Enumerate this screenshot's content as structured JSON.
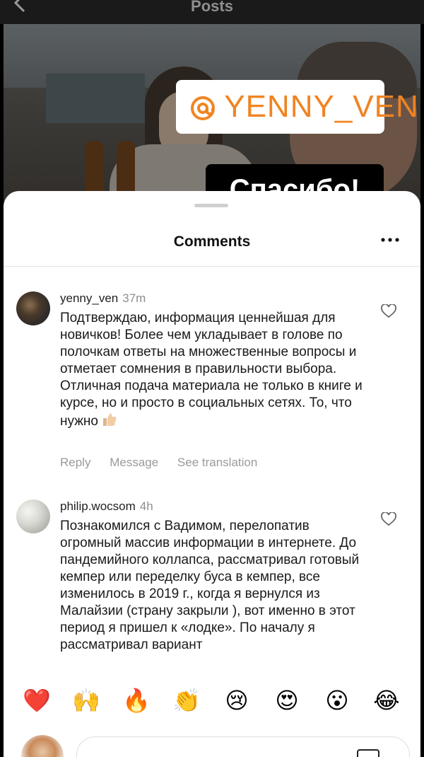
{
  "header": {
    "title": "Posts"
  },
  "story": {
    "tag_handle": "YENNY_VEN",
    "thanks_text": "Спасибо!",
    "tag_color": "#f08422"
  },
  "comments_sheet": {
    "title": "Comments",
    "comments": [
      {
        "username": "yenny_ven",
        "time": "37m",
        "text": "Подтверждаю, информация ценнейшая для новичков! Более чем укладывает в голове по полочкам ответы на множественные вопросы и отметает сомнения в правильности выбора. Отличная подача материала не только в книге и курсе, но и просто в социальных сетях. То, что нужно",
        "actions": {
          "reply": "Reply",
          "message": "Message",
          "see_translation": "See translation"
        }
      },
      {
        "username": "philip.wocsom",
        "time": "4h",
        "text": "Познакомился с Вадимом, перелопатив огромный массив информации в интернете. До пандемийного коллапса, рассматривал готовый кемпер или переделку буса в кемпер, все изменилось в 2019 г., когда я вернулся из Малайзии (страну закрыли ), вот именно в этот период я пришел к «лодке». По началу я рассматривал вариант"
      }
    ],
    "emoji_bar": [
      "❤️",
      "🙌",
      "🔥",
      "👏",
      "😢",
      "😍",
      "😮",
      "😂"
    ]
  },
  "icons": [
    "back-icon",
    "more-icon",
    "heart-icon",
    "at-icon",
    "thumbs-up-icon",
    "gif-icon"
  ]
}
